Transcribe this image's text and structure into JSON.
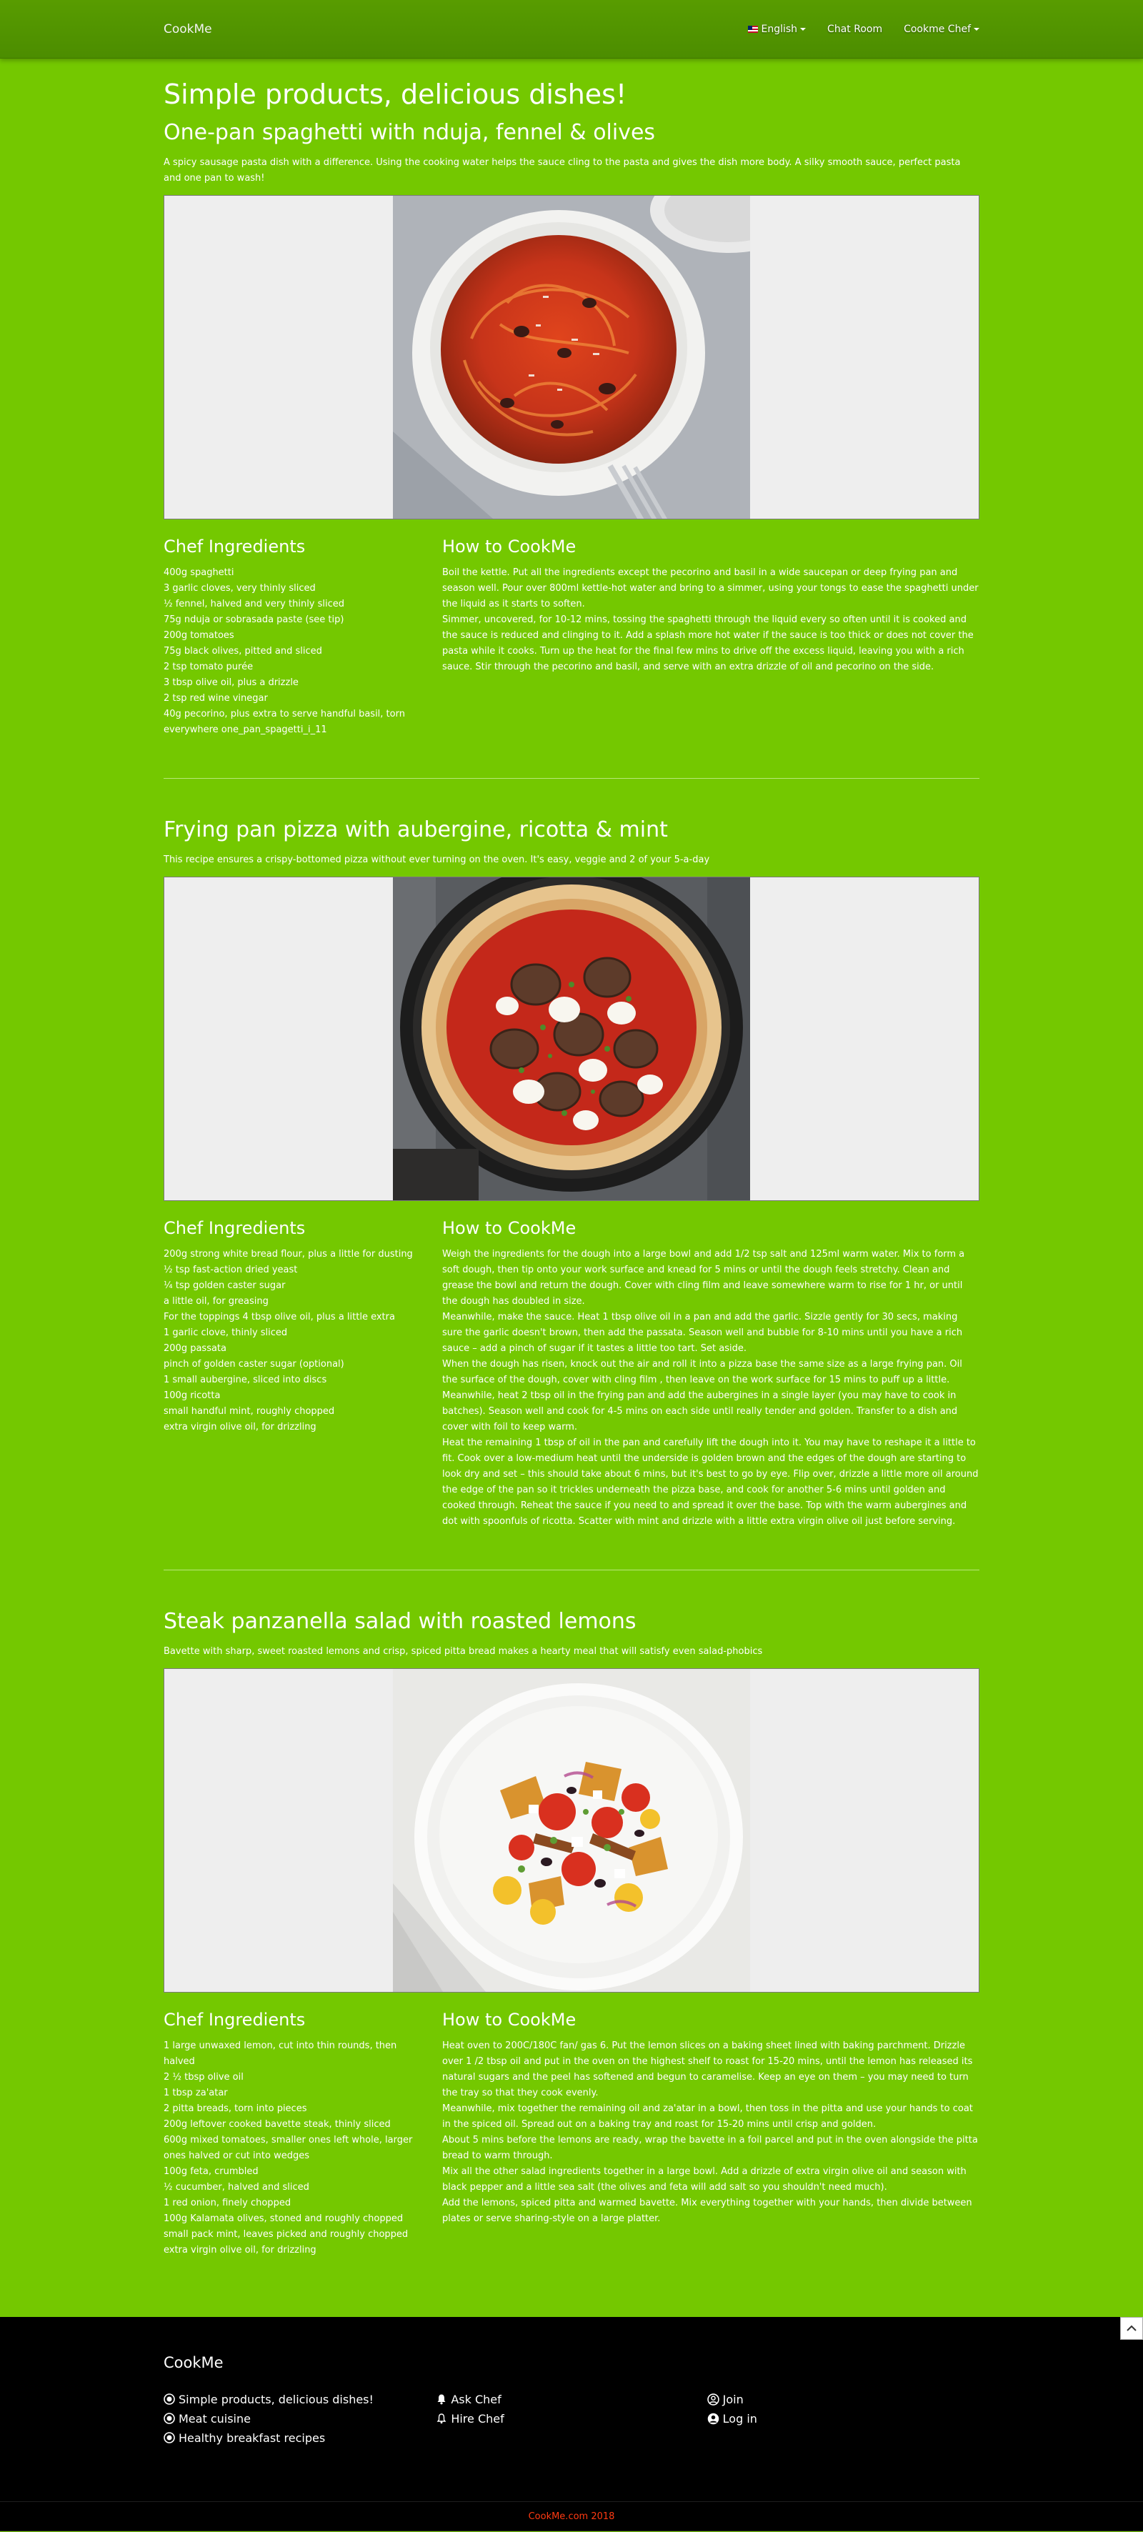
{
  "nav": {
    "brand": "CookMe",
    "language": "English",
    "chat_room": "Chat Room",
    "chef": "Cookme Chef"
  },
  "page_title": "Simple products, delicious dishes!",
  "labels": {
    "ingredients": "Chef Ingredients",
    "how_to": "How to CookMe"
  },
  "recipes": [
    {
      "title": "One-pan spaghetti with nduja, fennel & olives",
      "description": "A spicy sausage pasta dish with a difference. Using the cooking water helps the sauce cling to the pasta and gives the dish more body. A silky smooth sauce, perfect pasta and one pan to wash!",
      "ingredients": [
        "400g spaghetti",
        "3 garlic cloves, very thinly sliced",
        "½ fennel, halved and very thinly sliced",
        "75g nduja or sobrasada paste (see tip)",
        "200g tomatoes",
        "75g black olives, pitted and sliced",
        "2 tsp tomato purée",
        "3 tbsp olive oil, plus a drizzle",
        "2 tsp red wine vinegar",
        "40g pecorino, plus extra to serve handful basil, torn everywhere one_pan_spagetti_i_11"
      ],
      "steps": [
        "Boil the kettle. Put all the ingredients except the pecorino and basil in a wide saucepan or deep frying pan and season well. Pour over 800ml kettle-hot water and bring to a simmer, using your tongs to ease the spaghetti under the liquid as it starts to soften.",
        "Simmer, uncovered, for 10-12 mins, tossing the spaghetti through the liquid every so often until it is cooked and the sauce is reduced and clinging to it. Add a splash more hot water if the sauce is too thick or does not cover the pasta while it cooks. Turn up the heat for the final few mins to drive off the excess liquid, leaving you with a rich sauce. Stir through the pecorino and basil, and serve with an extra drizzle of oil and pecorino on the side."
      ]
    },
    {
      "title": "Frying pan pizza with aubergine, ricotta & mint",
      "description": "This recipe ensures a crispy-bottomed pizza without ever turning on the oven. It's easy, veggie and 2 of your 5-a-day",
      "ingredients": [
        "200g strong white bread flour, plus a little for dusting",
        "½ tsp fast-action dried yeast",
        "¼ tsp golden caster sugar",
        "a little oil, for greasing",
        "For the toppings 4 tbsp olive oil, plus a little extra",
        "1 garlic clove, thinly sliced",
        "200g passata",
        "pinch of golden caster sugar (optional)",
        "1 small aubergine, sliced into discs",
        "100g ricotta",
        "small handful mint, roughly chopped",
        "extra virgin olive oil, for drizzling"
      ],
      "steps": [
        "Weigh the ingredients for the dough into a large bowl and add 1/2 tsp salt and 125ml warm water. Mix to form a soft dough, then tip onto your work surface and knead for 5 mins or until the dough feels stretchy. Clean and grease the bowl and return the dough. Cover with cling film and leave somewhere warm to rise for 1 hr, or until the dough has doubled in size.",
        "Meanwhile, make the sauce. Heat 1 tbsp olive oil in a pan and add the garlic. Sizzle gently for 30 secs, making sure the garlic doesn't brown, then add the passata. Season well and bubble for 8-10 mins until you have a rich sauce – add a pinch of sugar if it tastes a little too tart. Set aside.",
        "When the dough has risen, knock out the air and roll it into a pizza base the same size as a large frying pan. Oil the surface of the dough, cover with cling film , then leave on the work surface for 15 mins to puff up a little. Meanwhile, heat 2 tbsp oil in the frying pan and add the aubergines in a single layer (you may have to cook in batches). Season well and cook for 4-5 mins on each side until really tender and golden. Transfer to a dish and cover with foil to keep warm.",
        "Heat the remaining 1 tbsp of oil in the pan and carefully lift the dough into it. You may have to reshape it a little to fit. Cook over a low-medium heat until the underside is golden brown and the edges of the dough are starting to look dry and set – this should take about 6 mins, but it's best to go by eye. Flip over, drizzle a little more oil around the edge of the pan so it trickles underneath the pizza base, and cook for another 5-6 mins until golden and cooked through. Reheat the sauce if you need to and spread it over the base. Top with the warm aubergines and dot with spoonfuls of ricotta. Scatter with mint and drizzle with a little extra virgin olive oil just before serving."
      ]
    },
    {
      "title": "Steak panzanella salad with roasted lemons",
      "description": "Bavette with sharp, sweet roasted lemons and crisp, spiced pitta bread makes a hearty meal that will satisfy even salad-phobics",
      "ingredients": [
        "1 large unwaxed lemon, cut into thin rounds, then halved",
        "2 ½ tbsp olive oil",
        "1 tbsp za'atar",
        "2 pitta breads, torn into pieces",
        "200g leftover cooked bavette steak, thinly sliced",
        "600g mixed tomatoes, smaller ones left whole, larger ones halved or cut into wedges",
        "100g feta, crumbled",
        "½ cucumber, halved and sliced",
        "1 red onion, finely chopped",
        "100g Kalamata olives, stoned and roughly chopped",
        "small pack mint, leaves picked and roughly chopped",
        "extra virgin olive oil, for drizzling"
      ],
      "steps": [
        "Heat oven to 200C/180C fan/ gas 6. Put the lemon slices on a baking sheet lined with baking parchment. Drizzle over 1 /2 tbsp oil and put in the oven on the highest shelf to roast for 15-20 mins, until the lemon has released its natural sugars and the peel has softened and begun to caramelise. Keep an eye on them – you may need to turn the tray so that they cook evenly.",
        "Meanwhile, mix together the remaining oil and za'atar in a bowl, then toss in the pitta and use your hands to coat in the spiced oil. Spread out on a baking tray and roast for 15-20 mins until crisp and golden.",
        "About 5 mins before the lemons are ready, wrap the bavette in a foil parcel and put in the oven alongside the pitta bread to warm through.",
        "Mix all the other salad ingredients together in a large bowl. Add a drizzle of extra virgin olive oil and season with black pepper and a little sea salt (the olives and feta will add salt so you shouldn't need much).",
        "Add the lemons, spiced pitta and warmed bavette. Mix everything together with your hands, then divide between plates or serve sharing-style on a large platter."
      ]
    }
  ],
  "footer": {
    "brand": "CookMe",
    "categories": [
      "Simple products, delicious dishes!",
      "Meat cuisine",
      "Healthy breakfast recipes"
    ],
    "ask_chef": "Ask Chef",
    "hire_chef": "Hire Chef",
    "join": "Join",
    "log_in": "Log in",
    "copyright": "CookMe.com 2018"
  },
  "colors": {
    "page_background": "#74c800",
    "navbar": "#4f8f00",
    "footer_background": "#000000",
    "copyright_text": "#ff3a12"
  }
}
